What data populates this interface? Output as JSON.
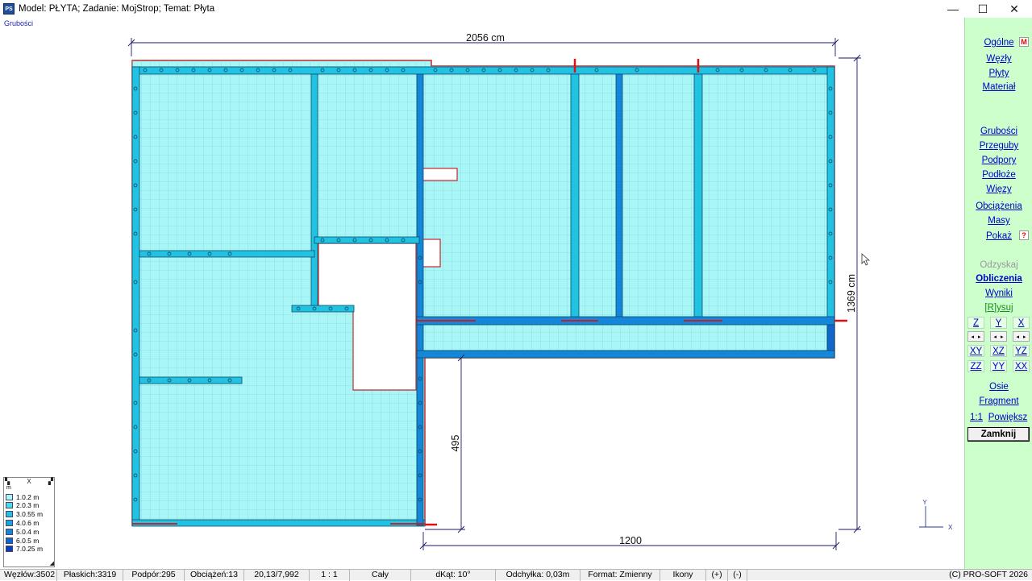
{
  "window": {
    "title": "Model: PŁYTA;  Zadanie: MojStrop;  Temat: Płyta",
    "icon_text": "PS",
    "minimize": "—",
    "maximize": "☐",
    "close": "✕"
  },
  "subtitle": "Grubości",
  "dimensions": {
    "top": "2056 cm",
    "right": "1369 cm",
    "inner": "495",
    "bottom": "1200"
  },
  "axes": {
    "y": "Y",
    "x": "X"
  },
  "legend": {
    "unit": "m",
    "close": "X",
    "items": [
      {
        "label": "1.0.2 m",
        "color": "#a9f6f6"
      },
      {
        "label": "2.0.3 m",
        "color": "#46dbe6"
      },
      {
        "label": "3.0.55 m",
        "color": "#21c2e2"
      },
      {
        "label": "4.0.6 m",
        "color": "#1aa5df"
      },
      {
        "label": "5.0.4 m",
        "color": "#1487d8"
      },
      {
        "label": "6.0.5 m",
        "color": "#0f66cc"
      },
      {
        "label": "7.0.25 m",
        "color": "#0a3fb8"
      }
    ]
  },
  "menu": {
    "ogolne": "Ogólne",
    "wezly": "Węzły",
    "plyty": "Płyty",
    "material": "Materiał",
    "grubosci": "Grubości",
    "przeguby": "Przeguby",
    "podpory": "Podpory",
    "podloze": "Podłoże",
    "wiezy": "Więzy",
    "obciazenia": "Obciążenia",
    "masy": "Masy",
    "pokaz": "Pokaż",
    "odzyskaj": "Odzyskaj",
    "obliczenia": "Obliczenia",
    "wyniki": "Wyniki",
    "rysuj": "[R]ysuj",
    "m_badge": "M",
    "q_badge": "?"
  },
  "views": {
    "z": "Z",
    "y": "Y",
    "x": "X",
    "xy": "XY",
    "xz": "XZ",
    "yz": "YZ",
    "zz": "ZZ",
    "yy": "YY",
    "xx": "XX"
  },
  "tools": {
    "osie": "Osie",
    "fragment": "Fragment",
    "one_to_one": "1:1",
    "powieksz": "Powiększ",
    "zamknij": "Zamknij"
  },
  "status": {
    "wezlow": "Węzłów:3502",
    "plaskich": "Płaskich:3319",
    "podpor": "Podpór:295",
    "obciazen": "Obciążeń:13",
    "coords": "20,13/7,992",
    "scale": "1 : 1",
    "range": "Cały",
    "dkat": "dKąt: 10°",
    "odchylka": "Odchyłka: 0,03m",
    "format": "Format: Zmienny",
    "ikony": "Ikony",
    "plus": "(+)",
    "minus": "(-)",
    "copyright": "(C) PRO-SOFT 2026"
  },
  "colors": {
    "slab": "#a9f6f6",
    "beam": "#21c2e2",
    "beam_dark": "#1487d8",
    "outline": "#c0282c",
    "dimension": "#1a1a66",
    "panel": "#ccffcc"
  }
}
